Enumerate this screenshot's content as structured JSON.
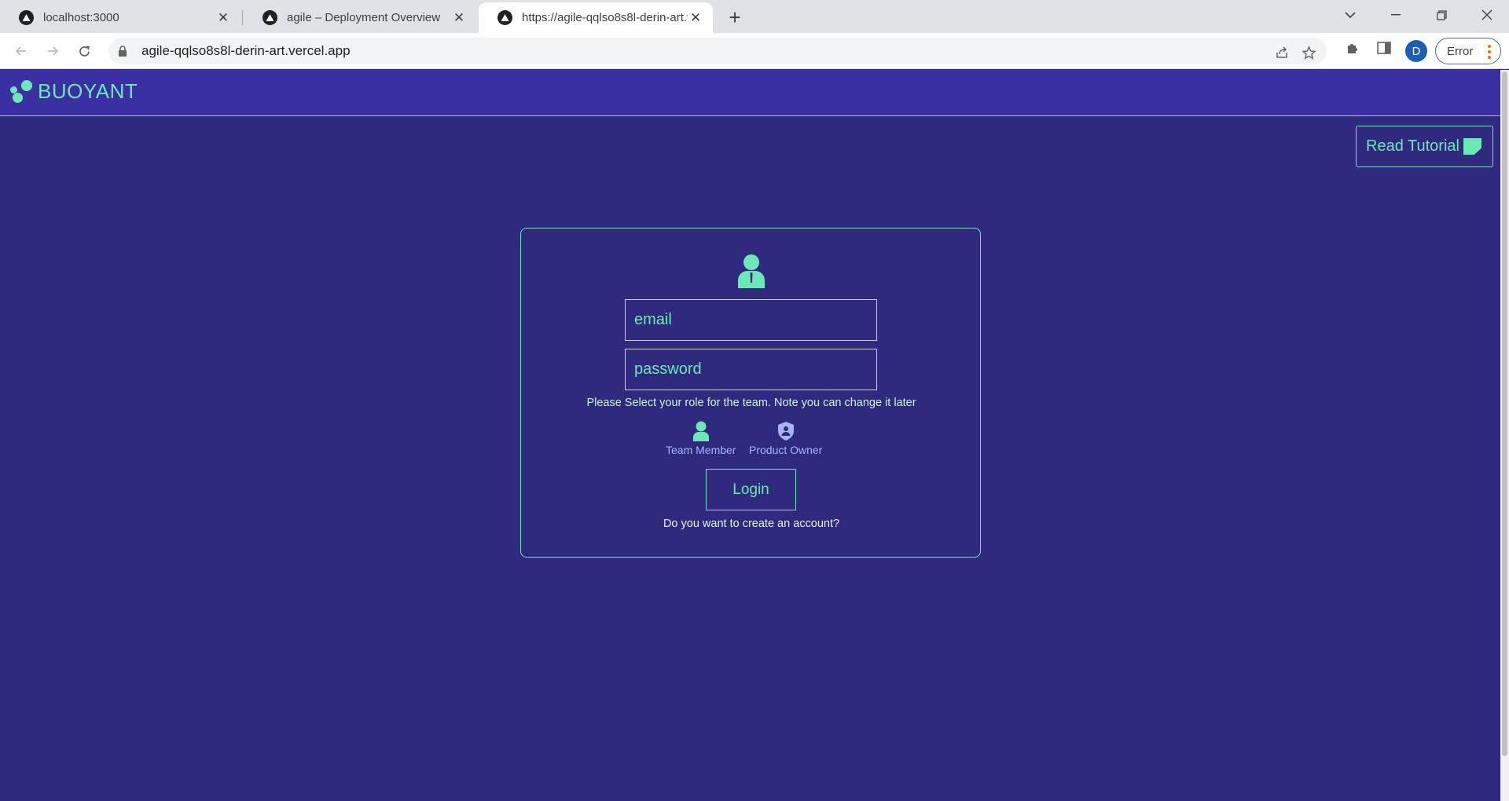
{
  "browser": {
    "tabs": [
      {
        "label": "localhost:3000",
        "active": false
      },
      {
        "label": "agile – Deployment Overview",
        "active": false
      },
      {
        "label": "https://agile-qqlso8s8l-derin-art.vercel.app",
        "active": true
      }
    ],
    "url": "agile-qqlso8s8l-derin-art.vercel.app",
    "profile_initial": "D",
    "error_label": "Error"
  },
  "app": {
    "brand": "BUOYANT",
    "tutorial_label": "Read Tutorial",
    "login": {
      "email_placeholder": "email",
      "password_placeholder": "password",
      "role_note": "Please Select your role for the team. Note you can change it later",
      "roles": [
        {
          "label": "Team Member",
          "icon": "person-icon",
          "color": "#6ee7b7"
        },
        {
          "label": "Product Owner",
          "icon": "shield-user-icon",
          "color": "#a5b4fc"
        }
      ],
      "submit_label": "Login",
      "signup_prompt": "Do you want to create an account?"
    }
  },
  "colors": {
    "background": "#2f2a7e",
    "header": "#3a30a3",
    "accent": "#6ee7b7"
  }
}
